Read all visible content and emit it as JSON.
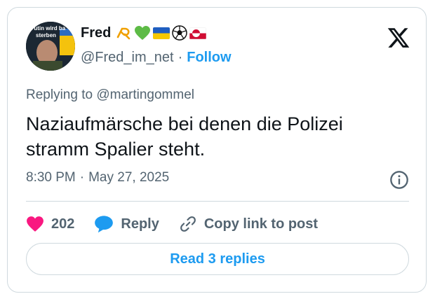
{
  "author": {
    "name": "Fred",
    "handle": "@Fred_im_net",
    "separator": "·",
    "follow_label": "Follow",
    "emojis": [
      "loop-icon",
      "green-heart-icon",
      "ukraine-flag-icon",
      "soccer-ball-icon",
      "greenland-flag-icon"
    ],
    "avatar_caption_line1": "Putin wird ba",
    "avatar_caption_line2": "sterben"
  },
  "reply": {
    "prefix": "Replying to",
    "to_handle": "@martingommel"
  },
  "tweet": {
    "text": "Naziaufmärsche bei denen die Polizei stramm Spalier steht.",
    "time": "8:30 PM",
    "separator": "·",
    "date": "May 27, 2025"
  },
  "actions": {
    "like_count": "202",
    "reply_label": "Reply",
    "copy_label": "Copy link to post"
  },
  "read_replies_label": "Read 3 replies",
  "colors": {
    "accent": "#1d9bf0",
    "like": "#f91880",
    "text": "#0f1419",
    "muted": "#536471",
    "border": "#cfd9de"
  }
}
